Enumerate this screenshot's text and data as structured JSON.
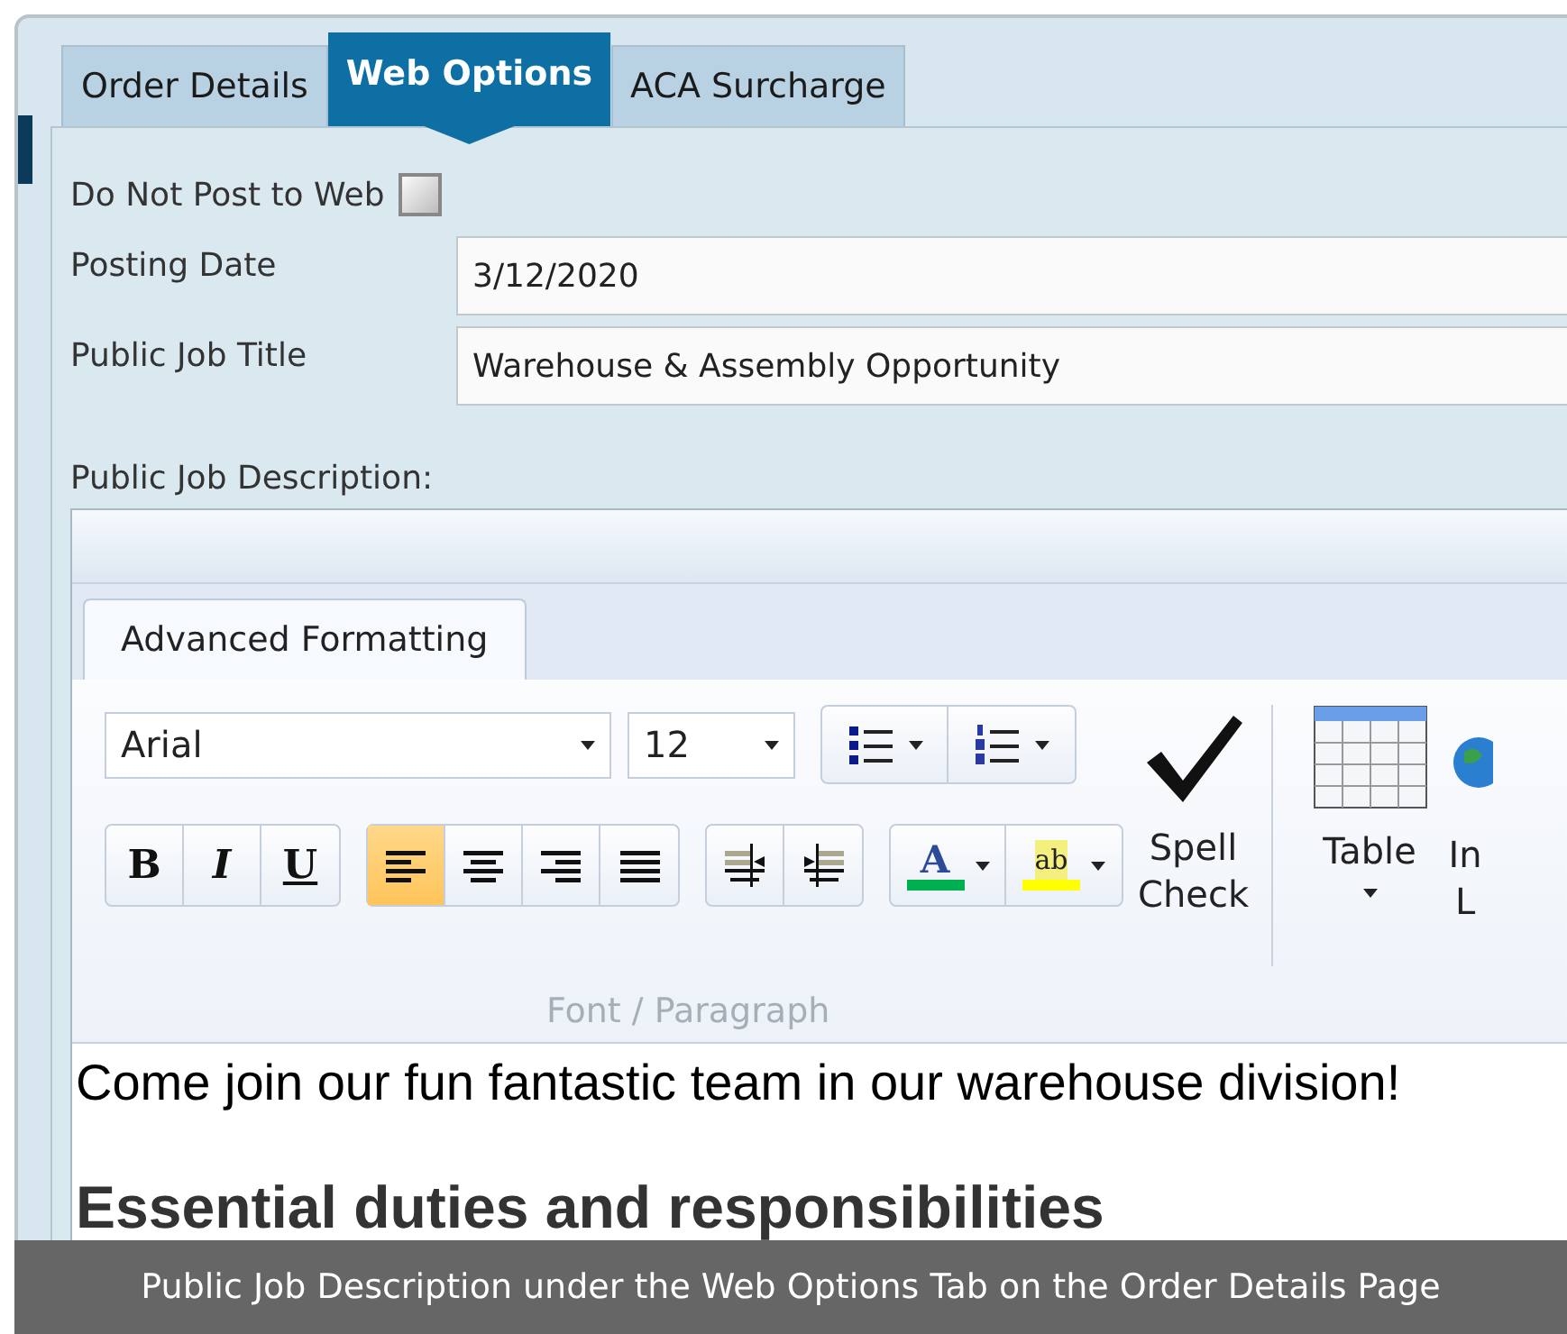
{
  "tabs": [
    {
      "label": "Order Details",
      "selected": false
    },
    {
      "label": "Web Options",
      "selected": true
    },
    {
      "label": "ACA Surcharge",
      "selected": false
    }
  ],
  "do_not_post": {
    "label": "Do Not Post to Web",
    "checked": false
  },
  "fields": [
    {
      "label": "Posting Date",
      "value": "3/12/2020"
    },
    {
      "label": "Public Job Title",
      "value": "Warehouse & Assembly Opportunity"
    }
  ],
  "description": {
    "label": "Public Job Description:",
    "ribbon_tabs": [
      {
        "label": "Advanced Formatting",
        "selected": true
      }
    ],
    "font": "Arial",
    "size": "12",
    "style_buttons": [
      {
        "kind": "bold",
        "label": "B",
        "selected": false
      },
      {
        "kind": "italic",
        "label": "I",
        "selected": false
      },
      {
        "kind": "underline",
        "label": "U",
        "selected": false
      }
    ],
    "align_buttons": [
      {
        "kind": "left",
        "selected": true
      },
      {
        "kind": "center",
        "selected": false
      },
      {
        "kind": "right",
        "selected": false
      },
      {
        "kind": "justify",
        "selected": false
      }
    ],
    "color_buttons": [
      {
        "kind": "font-color",
        "label": "A",
        "color": "#00b050"
      },
      {
        "kind": "highlight",
        "label": "ab",
        "color": "#ffff00"
      }
    ],
    "group_label": "Font / Paragraph",
    "big_buttons": [
      {
        "kind": "spell",
        "lines": [
          "Spell",
          "Check"
        ]
      },
      {
        "kind": "table",
        "lines": [
          "Table"
        ]
      },
      {
        "kind": "link",
        "lines": [
          "In",
          "L"
        ]
      }
    ],
    "content": [
      {
        "kind": "paragraph",
        "text": "Come join our fun fantastic team in our warehouse division!"
      },
      {
        "kind": "heading",
        "text": "Essential duties and responsibilities"
      }
    ]
  },
  "caption": "Public Job Description under the Web Options Tab on the Order Details Page"
}
